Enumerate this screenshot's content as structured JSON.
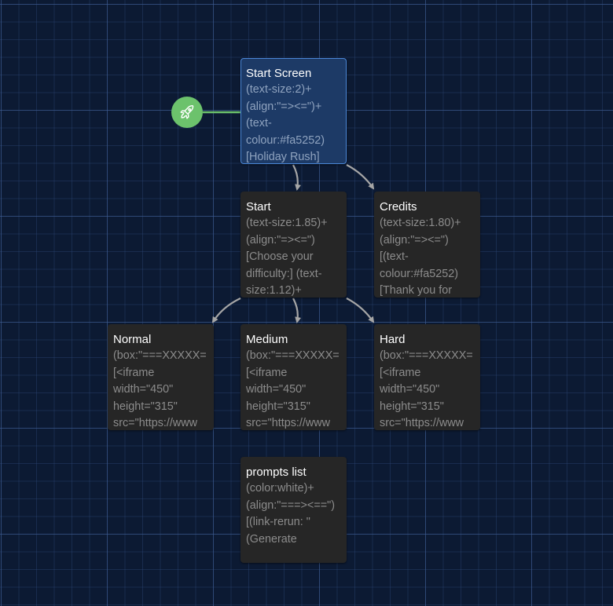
{
  "passages": [
    {
      "name": "Start Screen",
      "excerpt": "(text-size:2)+(align:\"=><=\")+(text-colour:#fa5252)[Holiday Rush]"
    },
    {
      "name": "Start",
      "excerpt": "(text-size:1.85)+(align:\"=><=\")[Choose your difficulty:] (text-size:1.12)+"
    },
    {
      "name": "Credits",
      "excerpt": "(text-size:1.80)+(align:\"=><=\")[(text-colour:#fa5252)[Thank you for"
    },
    {
      "name": "Normal",
      "line1": "(box:\"===XXXXX=",
      "excerpt": "[<iframe width=\"450\" height=\"315\" src=\"https://www"
    },
    {
      "name": "Medium",
      "line1": "(box:\"===XXXXX=",
      "excerpt": "[<iframe width=\"450\" height=\"315\" src=\"https://www"
    },
    {
      "name": "Hard",
      "line1": "(box:\"===XXXXX=",
      "excerpt": "[<iframe width=\"450\" height=\"315\" src=\"https://www"
    },
    {
      "name": "prompts list",
      "excerpt": "(color:white)+(align:\"===><==\")[(link-rerun: \"(Generate"
    }
  ],
  "start_badge": {
    "icon": "rocket-icon",
    "color": "#6cc26c"
  },
  "colors": {
    "background": "#0c1a33",
    "passage": "#262626",
    "selected_passage": "#1d3a66",
    "selected_border": "#4a86d6",
    "arrow": "#a6a6a6"
  }
}
